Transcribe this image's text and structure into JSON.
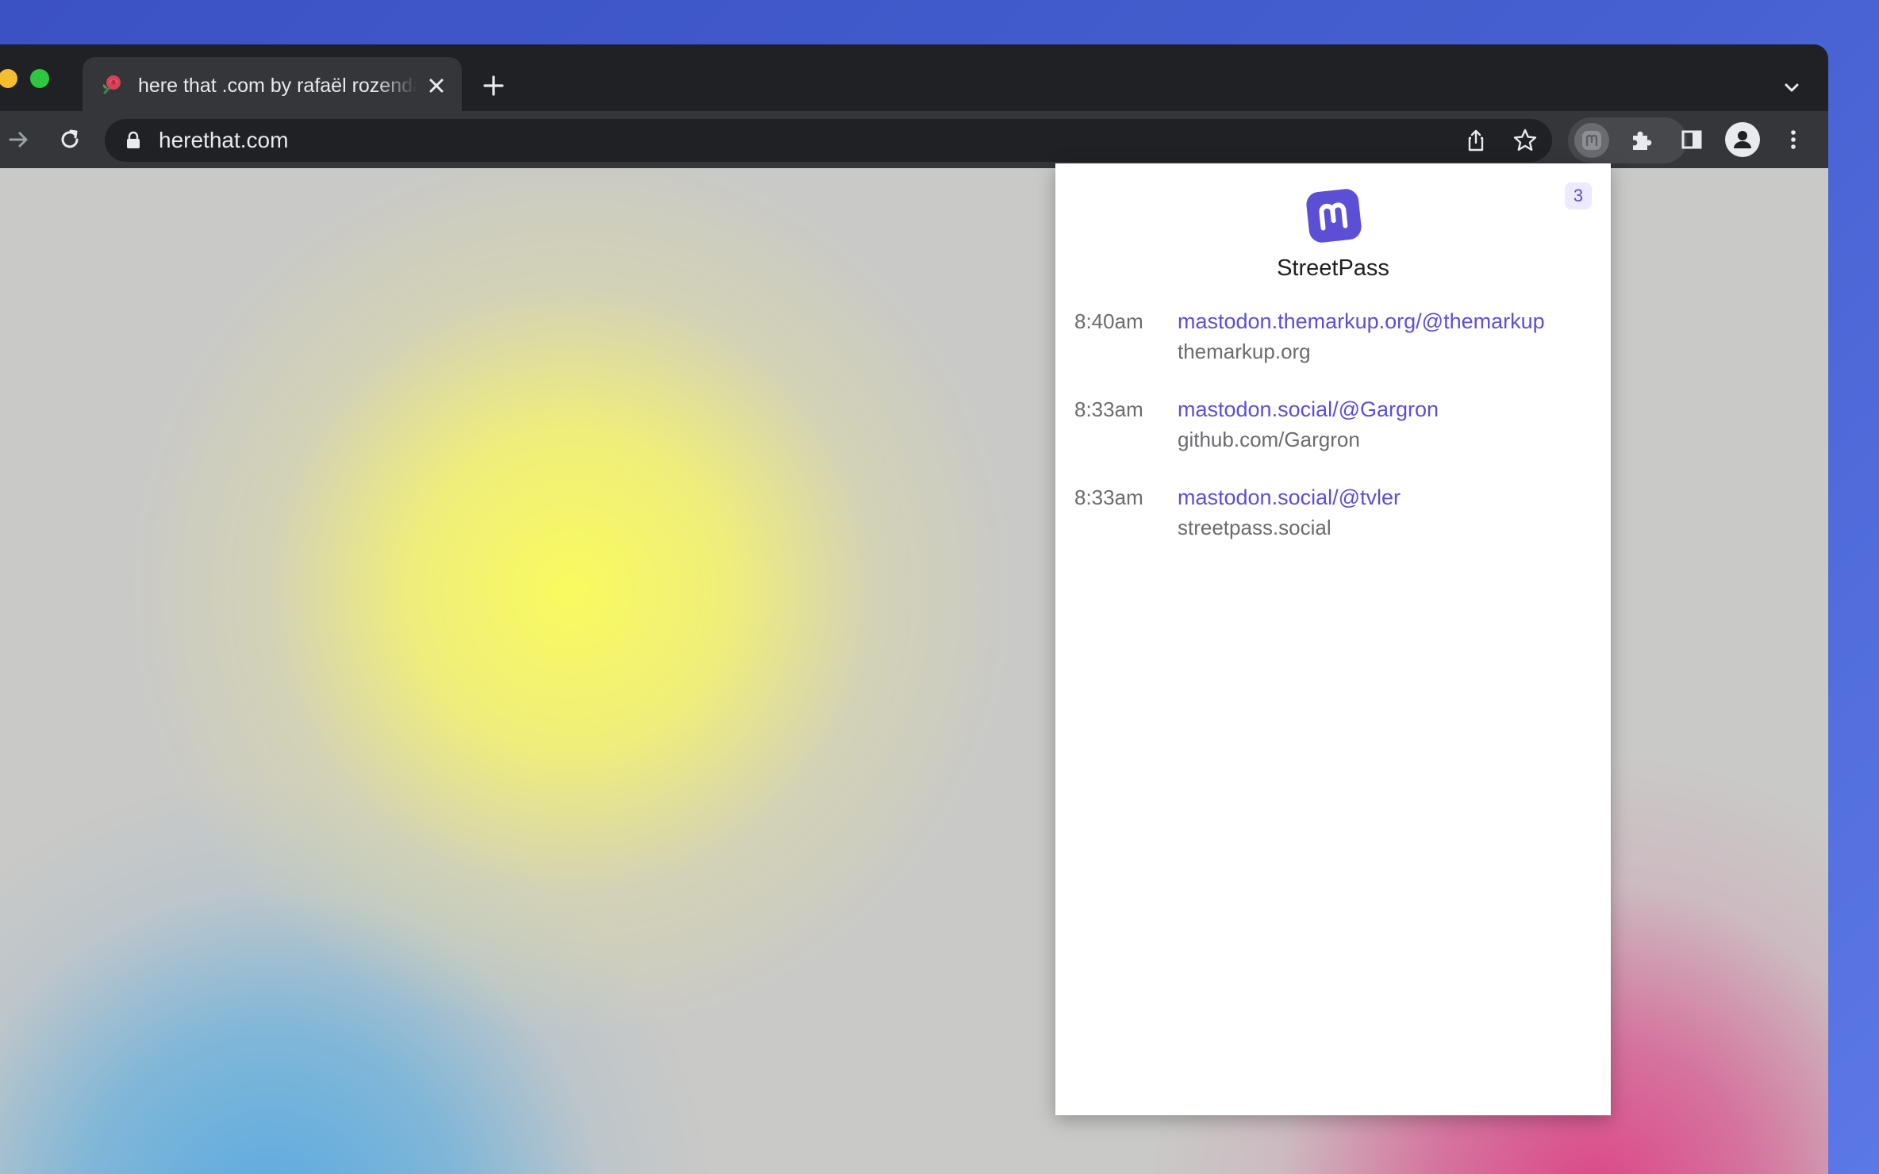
{
  "browser": {
    "tab": {
      "title": "here that .com by rafaël rozendaal",
      "favicon": "rose-icon"
    },
    "url": "herethat.com",
    "icons": {
      "forward": "forward-arrow-icon",
      "reload": "reload-icon",
      "lock": "lock-icon",
      "share": "share-icon",
      "bookmark": "star-icon",
      "extension_active": "mastodon-icon",
      "extensions": "puzzle-icon",
      "side_panel": "side-panel-icon",
      "profile": "profile-icon",
      "menu": "more-vertical-icon",
      "tab_list": "chevron-down-icon",
      "new_tab": "plus-icon",
      "close_tab": "close-icon"
    }
  },
  "popup": {
    "title": "StreetPass",
    "count": "3",
    "logo": "mastodon-logo",
    "entries": [
      {
        "time": "8:40am",
        "handle": "mastodon.themarkup.org/@themarkup",
        "source": "themarkup.org"
      },
      {
        "time": "8:33am",
        "handle": "mastodon.social/@Gargron",
        "source": "github.com/Gargron"
      },
      {
        "time": "8:33am",
        "handle": "mastodon.social/@tvler",
        "source": "streetpass.social"
      }
    ]
  },
  "colors": {
    "accent": "#5b4fd6",
    "desktop": "#3b52c4",
    "chrome_dark": "#202124",
    "chrome_toolbar": "#35363a"
  }
}
